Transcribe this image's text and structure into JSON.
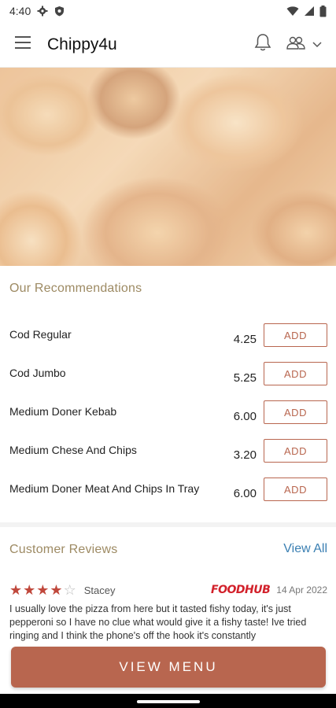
{
  "status_bar": {
    "time": "4:40"
  },
  "app_bar": {
    "title": "Chippy4u"
  },
  "recommendations": {
    "title": "Our Recommendations",
    "add_label": "ADD",
    "items": [
      {
        "name": "Cod Regular",
        "price": "4.25"
      },
      {
        "name": "Cod Jumbo",
        "price": "5.25"
      },
      {
        "name": "Medium Doner Kebab",
        "price": "6.00"
      },
      {
        "name": "Medium Chese And Chips",
        "price": "3.20"
      },
      {
        "name": "Medium Doner Meat And Chips In Tray",
        "price": "6.00"
      }
    ]
  },
  "reviews": {
    "title": "Customer Reviews",
    "view_all": "View All",
    "items": [
      {
        "rating": 4,
        "max_rating": 5,
        "reviewer": "Stacey",
        "source": "FOODHUB",
        "date": "14 Apr 2022",
        "text": "I usually love the pizza from here but it tasted fishy today, it's just pepperoni so I have no clue what would give it a fishy taste! Ive tried ringing and I think the phone's off the hook it's constantly"
      }
    ]
  },
  "cta": {
    "label": "VIEW MENU"
  },
  "colors": {
    "accent": "#b8664f",
    "section_title": "#9d8a63",
    "link": "#3a7fb2",
    "star": "#c0483c",
    "brand": "#d2202a"
  }
}
